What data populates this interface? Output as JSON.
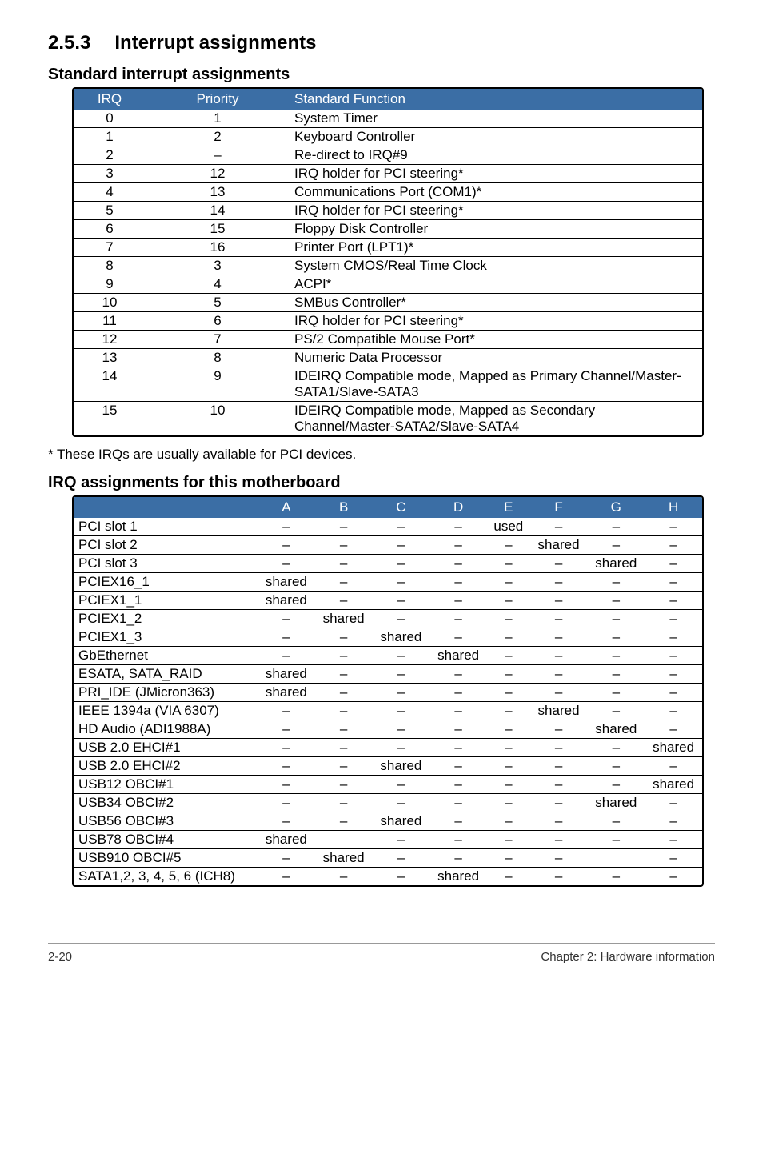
{
  "section_number": "2.5.3",
  "section_title": "Interrupt assignments",
  "subtitle_1": "Standard interrupt assignments",
  "table1_headers": {
    "irq": "IRQ",
    "priority": "Priority",
    "fn": "Standard Function"
  },
  "table1_rows": [
    {
      "irq": "0",
      "priority": "1",
      "fn": "System Timer"
    },
    {
      "irq": "1",
      "priority": "2",
      "fn": "Keyboard Controller"
    },
    {
      "irq": "2",
      "priority": "–",
      "fn": "Re-direct to IRQ#9"
    },
    {
      "irq": "3",
      "priority": "12",
      "fn": "IRQ holder for PCI steering*"
    },
    {
      "irq": "4",
      "priority": "13",
      "fn": "Communications Port (COM1)*"
    },
    {
      "irq": "5",
      "priority": "14",
      "fn": "IRQ holder for PCI steering*"
    },
    {
      "irq": "6",
      "priority": "15",
      "fn": "Floppy Disk Controller"
    },
    {
      "irq": "7",
      "priority": "16",
      "fn": "Printer Port (LPT1)*"
    },
    {
      "irq": "8",
      "priority": "3",
      "fn": "System CMOS/Real Time Clock"
    },
    {
      "irq": "9",
      "priority": "4",
      "fn": "ACPI*"
    },
    {
      "irq": "10",
      "priority": "5",
      "fn": "SMBus Controller*"
    },
    {
      "irq": "11",
      "priority": "6",
      "fn": "IRQ holder for PCI steering*"
    },
    {
      "irq": "12",
      "priority": "7",
      "fn": "PS/2 Compatible Mouse Port*"
    },
    {
      "irq": "13",
      "priority": "8",
      "fn": "Numeric Data Processor"
    },
    {
      "irq": "14",
      "priority": "9",
      "fn": "IDEIRQ Compatible mode, Mapped as Primary Channel/Master-SATA1/Slave-SATA3"
    },
    {
      "irq": "15",
      "priority": "10",
      "fn": "IDEIRQ Compatible mode, Mapped as Secondary Channel/Master-SATA2/Slave-SATA4"
    }
  ],
  "footnote": "* These IRQs are usually available for PCI devices.",
  "subtitle_2": "IRQ assignments for this motherboard",
  "table2_headers": [
    "",
    "A",
    "B",
    "C",
    "D",
    "E",
    "F",
    "G",
    "H"
  ],
  "table2_rows": [
    {
      "label": "PCI slot 1",
      "cells": [
        "–",
        "–",
        "–",
        "–",
        "used",
        "–",
        "–",
        "–"
      ]
    },
    {
      "label": "PCI slot 2",
      "cells": [
        "–",
        "–",
        "–",
        "–",
        "–",
        "shared",
        "–",
        "–"
      ]
    },
    {
      "label": "PCI slot 3",
      "cells": [
        "–",
        "–",
        "–",
        "–",
        "–",
        "–",
        "shared",
        "–"
      ]
    },
    {
      "label": "PCIEX16_1",
      "cells": [
        "shared",
        "–",
        "–",
        "–",
        "–",
        "–",
        "–",
        "–"
      ]
    },
    {
      "label": "PCIEX1_1",
      "cells": [
        "shared",
        "–",
        "–",
        "–",
        "–",
        "–",
        "–",
        "–"
      ]
    },
    {
      "label": "PCIEX1_2",
      "cells": [
        "–",
        "shared",
        "–",
        "–",
        "–",
        "–",
        "–",
        "–"
      ]
    },
    {
      "label": "PCIEX1_3",
      "cells": [
        "–",
        "–",
        "shared",
        "–",
        "–",
        "–",
        "–",
        "–"
      ]
    },
    {
      "label": "GbEthernet",
      "cells": [
        "–",
        "–",
        "–",
        "shared",
        "–",
        "–",
        "–",
        "–"
      ]
    },
    {
      "label": "ESATA, SATA_RAID",
      "cells": [
        "shared",
        "–",
        "–",
        "–",
        "–",
        "–",
        "–",
        "–"
      ]
    },
    {
      "label": "PRI_IDE (JMicron363)",
      "cells": [
        "shared",
        "–",
        "–",
        "–",
        "–",
        "–",
        "–",
        "–"
      ]
    },
    {
      "label": "IEEE 1394a (VIA 6307)",
      "cells": [
        "–",
        "–",
        "–",
        "–",
        "–",
        "shared",
        "–",
        "–"
      ]
    },
    {
      "label": "HD Audio (ADI1988A)",
      "cells": [
        "–",
        "–",
        "–",
        "–",
        "–",
        "–",
        "shared",
        "–"
      ]
    },
    {
      "label": "USB 2.0 EHCI#1",
      "cells": [
        "–",
        "–",
        "–",
        "–",
        "–",
        "–",
        "–",
        "shared"
      ]
    },
    {
      "label": "USB 2.0 EHCI#2",
      "cells": [
        "–",
        "–",
        "shared",
        "–",
        "–",
        "–",
        "–",
        "–"
      ]
    },
    {
      "label": "USB12 OBCI#1",
      "cells": [
        "–",
        "–",
        "–",
        "–",
        "–",
        "–",
        "–",
        "shared"
      ]
    },
    {
      "label": "USB34 OBCI#2",
      "cells": [
        "–",
        "–",
        "–",
        "–",
        "–",
        "–",
        "shared",
        "–"
      ]
    },
    {
      "label": "USB56 OBCI#3",
      "cells": [
        "–",
        "–",
        "shared",
        "–",
        "–",
        "–",
        "–",
        "–"
      ]
    },
    {
      "label": "USB78 OBCI#4",
      "cells": [
        "shared",
        "",
        "–",
        "–",
        "–",
        "–",
        "–",
        "–"
      ]
    },
    {
      "label": "USB910 OBCI#5",
      "cells": [
        "–",
        "shared",
        "–",
        "–",
        "–",
        "–",
        "",
        "–"
      ]
    },
    {
      "label": "SATA1,2, 3, 4, 5, 6 (ICH8)",
      "cells": [
        "–",
        "–",
        "–",
        "shared",
        "–",
        "–",
        "–",
        "–"
      ]
    }
  ],
  "footer_left": "2-20",
  "footer_right": "Chapter 2: Hardware information"
}
